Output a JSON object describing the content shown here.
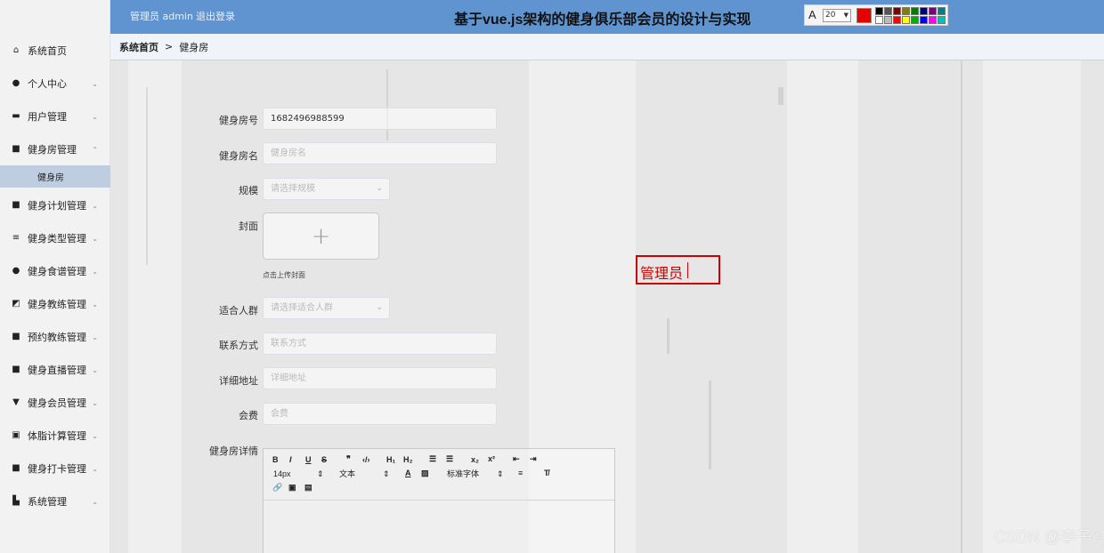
{
  "header": {
    "user": "管理员 admin",
    "logout": "退出登录",
    "title": "基于vue.js架构的健身俱乐部会员的设计与实现"
  },
  "draw_toolbar": {
    "font_icon": "A",
    "font_size": "20",
    "current_color": "#e60000",
    "palette": [
      "#000000",
      "#555555",
      "#7f0000",
      "#7f7f00",
      "#007f00",
      "#00007f",
      "#7f007f",
      "#007f7f",
      "#ffffff",
      "#bbbbbb",
      "#ff0000",
      "#ffff00",
      "#00b000",
      "#0000ff",
      "#ff00ff",
      "#00c0c0"
    ]
  },
  "sidebar": {
    "items": [
      {
        "label": "系统首页",
        "icon": "home-icon",
        "glyph": "⌂",
        "arrow": ""
      },
      {
        "label": "个人中心",
        "icon": "user-icon",
        "glyph": "●",
        "arrow": "⌄"
      },
      {
        "label": "用户管理",
        "icon": "briefcase-icon",
        "glyph": "▬",
        "arrow": "⌄"
      },
      {
        "label": "健身房管理",
        "icon": "grid-icon",
        "glyph": "■",
        "arrow": "⌃"
      },
      {
        "label": "健身计划管理",
        "icon": "grid-icon",
        "glyph": "■",
        "arrow": "⌄"
      },
      {
        "label": "健身类型管理",
        "icon": "list-icon",
        "glyph": "≡",
        "arrow": "⌄"
      },
      {
        "label": "健身食谱管理",
        "icon": "pin-icon",
        "glyph": "●",
        "arrow": "⌄"
      },
      {
        "label": "健身教练管理",
        "icon": "chart-icon",
        "glyph": "◩",
        "arrow": "⌄"
      },
      {
        "label": "预约教练管理",
        "icon": "grid-icon",
        "glyph": "■",
        "arrow": "⌄"
      },
      {
        "label": "健身直播管理",
        "icon": "grid-icon",
        "glyph": "■",
        "arrow": "⌄"
      },
      {
        "label": "健身会员管理",
        "icon": "trophy-icon",
        "glyph": "▼",
        "arrow": "⌄"
      },
      {
        "label": "体脂计算管理",
        "icon": "calculator-icon",
        "glyph": "▣",
        "arrow": "⌄"
      },
      {
        "label": "健身打卡管理",
        "icon": "grid-icon",
        "glyph": "■",
        "arrow": "⌄"
      },
      {
        "label": "系统管理",
        "icon": "settings-icon",
        "glyph": "▙",
        "arrow": "⌄"
      }
    ],
    "sub_item": "健身房"
  },
  "breadcrumb": {
    "home": "系统首页",
    "sep": ">",
    "current": "健身房"
  },
  "form": {
    "gym_no": {
      "label": "健身房号",
      "value": "1682496988599"
    },
    "gym_name": {
      "label": "健身房名",
      "placeholder": "健身房名"
    },
    "scale": {
      "label": "规模",
      "placeholder": "请选择规模"
    },
    "cover": {
      "label": "封面",
      "tip": "点击上传封面"
    },
    "audience": {
      "label": "适合人群",
      "placeholder": "请选择适合人群"
    },
    "contact": {
      "label": "联系方式",
      "placeholder": "联系方式"
    },
    "address": {
      "label": "详细地址",
      "placeholder": "详细地址"
    },
    "fee": {
      "label": "会费",
      "placeholder": "会费"
    },
    "detail": {
      "label": "健身房详情"
    }
  },
  "editor": {
    "font_size": "14px",
    "format": "文本",
    "font_family": "标准字体"
  },
  "annotation": {
    "text": "管理员"
  },
  "watermark": "CSDN @李子c"
}
